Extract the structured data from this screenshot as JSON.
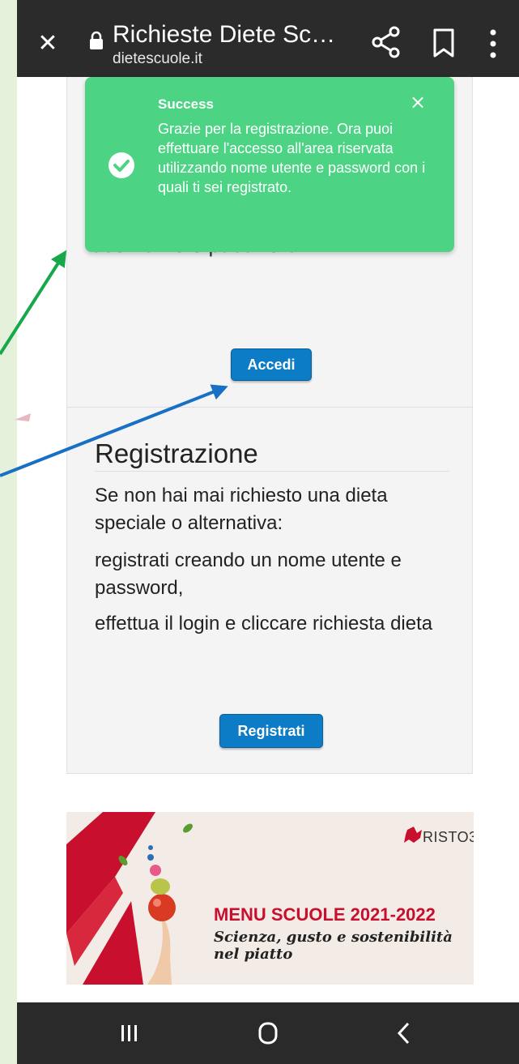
{
  "browser": {
    "title": "Richieste Diete Sc…",
    "url": "dietescuole.it",
    "close_icon": "close-icon",
    "lock_icon": "lock-icon",
    "share_icon": "share-icon",
    "bookmark_icon": "bookmark-icon",
    "menu_icon": "more-vert-icon"
  },
  "toast": {
    "title": "Success",
    "message": "Grazie per la registrazione. Ora puoi effettuare l'accesso all'area riservata utilizzando nome utente e password con i quali ti sei registrato.",
    "close": "×",
    "color": "#4cd484"
  },
  "login": {
    "hidden_text": "username e password",
    "button_label": "Accedi"
  },
  "registration": {
    "title": "Registrazione",
    "paragraphs": [
      "Se non hai mai richiesto una dieta speciale o alternativa:",
      "registrati creando un nome utente e password,",
      "effettua il login e cliccare richiesta dieta"
    ],
    "button_label": "Registrati"
  },
  "banner": {
    "logo": "RISTO3",
    "title": "MENU SCUOLE 2021-2022",
    "subtitle": "Scienza, gusto e sostenibilità nel piatto"
  },
  "colors": {
    "button": "#0d7cc7",
    "accent_red": "#c8102e",
    "annotation_green": "#17a84c",
    "annotation_blue": "#1870c4"
  }
}
